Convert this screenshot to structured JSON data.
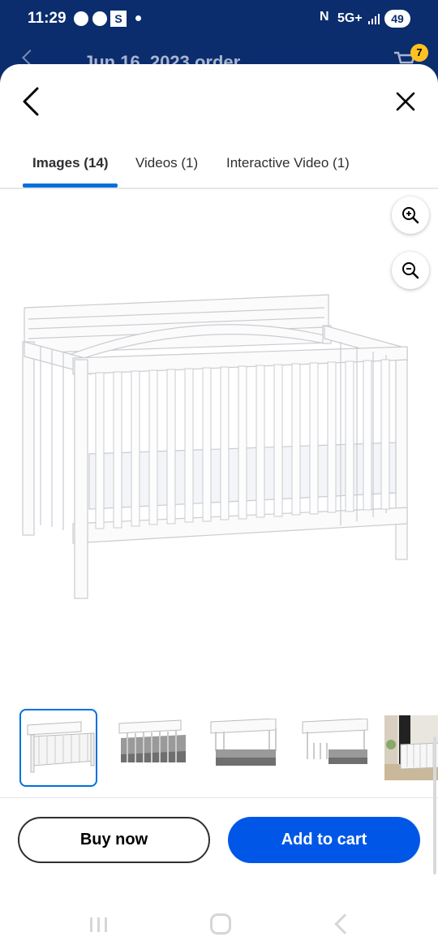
{
  "status_bar": {
    "time": "11:29",
    "app_badge": "S",
    "network": "5G+",
    "battery": "49",
    "icons": [
      "clock-icon",
      "whatsapp-icon",
      "nfc-icon",
      "signal-icon",
      "battery-icon"
    ]
  },
  "background_page": {
    "title": "Jun 16, 2023 order",
    "cart_count": "7"
  },
  "sheet": {
    "tabs": [
      {
        "label": "Images (14)",
        "active": true
      },
      {
        "label": "Videos (1)",
        "active": false
      },
      {
        "label": "Interactive Video (1)",
        "active": false
      }
    ],
    "zoom": {
      "in_icon": "zoom-in-icon",
      "out_icon": "zoom-out-icon"
    },
    "main_image": "white-convertible-crib",
    "thumbnails": [
      {
        "name": "crib-front-view",
        "selected": true
      },
      {
        "name": "crib-with-gray-skirt",
        "selected": false
      },
      {
        "name": "crib-toddler-bed",
        "selected": false
      },
      {
        "name": "crib-toddler-rail",
        "selected": false
      },
      {
        "name": "crib-room-scene",
        "selected": false
      }
    ],
    "buttons": {
      "buy_now": "Buy now",
      "add_to_cart": "Add to cart"
    }
  },
  "colors": {
    "header_bg": "#0b2d6e",
    "accent_blue": "#0071dc",
    "add_to_cart_bg": "#0057e7",
    "cart_badge": "#ffc220"
  }
}
